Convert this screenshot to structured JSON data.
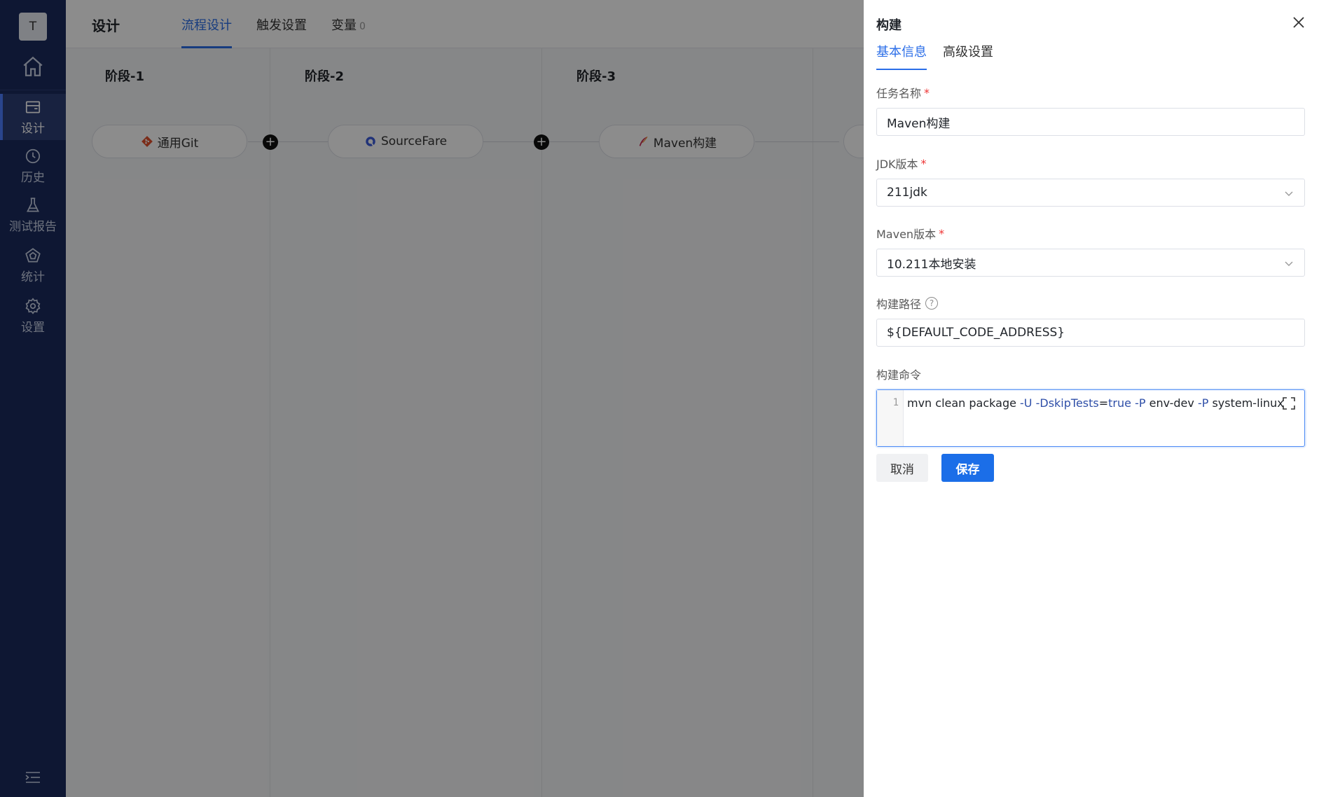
{
  "nav": {
    "avatar_letter": "T",
    "items": [
      {
        "label": "设计",
        "icon": "design-icon"
      },
      {
        "label": "历史",
        "icon": "history-icon"
      },
      {
        "label": "测试报告",
        "icon": "flask-icon"
      },
      {
        "label": "统计",
        "icon": "statistics-icon"
      },
      {
        "label": "设置",
        "icon": "gear-icon"
      }
    ]
  },
  "header": {
    "title": "设计",
    "tabs": [
      {
        "label": "流程设计",
        "active": true
      },
      {
        "label": "触发设置"
      },
      {
        "label": "变量",
        "count": "0"
      }
    ]
  },
  "stages": [
    {
      "title": "阶段-1",
      "task": "通用Git",
      "task_icon": "git-icon"
    },
    {
      "title": "阶段-2",
      "task": "SourceFare",
      "task_icon": "sourcefare-icon"
    },
    {
      "title": "阶段-3",
      "task": "Maven构建",
      "task_icon": "maven-icon"
    }
  ],
  "drawer": {
    "title": "构建",
    "tabs": [
      {
        "label": "基本信息",
        "active": true
      },
      {
        "label": "高级设置"
      }
    ],
    "fields": {
      "task_name": {
        "label": "任务名称",
        "value": "Maven构建",
        "required": true
      },
      "jdk": {
        "label": "JDK版本",
        "value": "211jdk",
        "required": true
      },
      "maven": {
        "label": "Maven版本",
        "value": "10.211本地安装",
        "required": true
      },
      "path": {
        "label": "构建路径",
        "value": "${DEFAULT_CODE_ADDRESS}"
      },
      "command": {
        "label": "构建命令",
        "line_number": "1",
        "tokens": {
          "t1": "mvn clean package ",
          "t2": "-U",
          "t3": " ",
          "t4": "-DskipTests",
          "t5": "=",
          "t6": "true",
          "t7": " ",
          "t8": "-P",
          "t9": " env-dev ",
          "t10": "-P",
          "t11": " system-linux"
        }
      }
    },
    "cancel_label": "取消",
    "save_label": "保存"
  },
  "colors": {
    "sidebar": "#1a2b5e",
    "accent": "#2b6ee8",
    "required": "#e33333",
    "overlay": "rgba(0,0,0,0.45)"
  }
}
